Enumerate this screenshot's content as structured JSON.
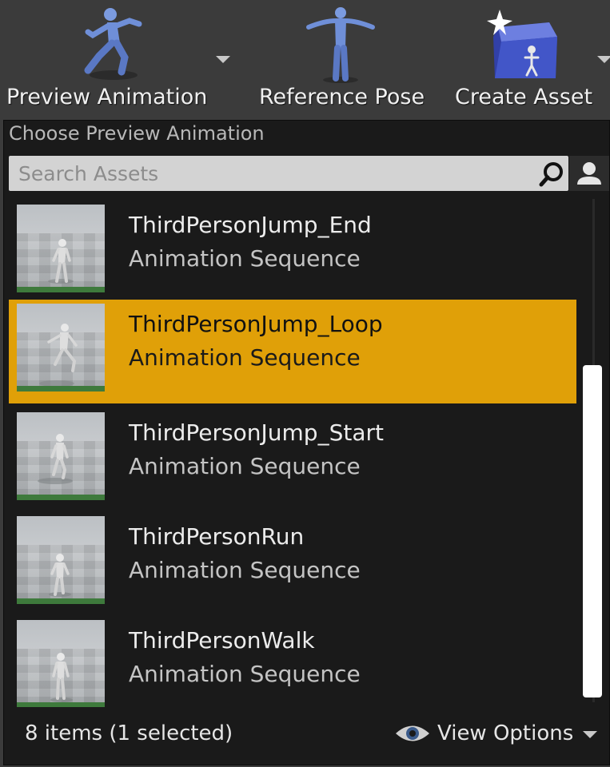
{
  "toolbar": {
    "preview_animation": {
      "label": "Preview Animation",
      "icon": "running-mannequin-icon"
    },
    "reference_pose": {
      "label": "Reference Pose",
      "icon": "t-pose-mannequin-icon"
    },
    "create_asset": {
      "label": "Create Asset",
      "icon": "create-asset-icon"
    }
  },
  "panel": {
    "title": "Choose Preview Animation",
    "search": {
      "placeholder": "Search Assets",
      "value": ""
    },
    "items": [
      {
        "name": "ThirdPersonJump_End",
        "type": "Animation Sequence",
        "selected": false
      },
      {
        "name": "ThirdPersonJump_Loop",
        "type": "Animation Sequence",
        "selected": true
      },
      {
        "name": "ThirdPersonJump_Start",
        "type": "Animation Sequence",
        "selected": false
      },
      {
        "name": "ThirdPersonRun",
        "type": "Animation Sequence",
        "selected": false
      },
      {
        "name": "ThirdPersonWalk",
        "type": "Animation Sequence",
        "selected": false
      }
    ],
    "footer": {
      "count_text": "8 items (1 selected)",
      "view_options_label": "View Options"
    }
  },
  "colors": {
    "toolbar_bg": "#3b3b3b",
    "panel_bg": "#1a1a1a",
    "selection": "#e0a008",
    "thumbnail_bar": "#3e7a3c",
    "mannequin_blue": "#6f8fd8"
  }
}
